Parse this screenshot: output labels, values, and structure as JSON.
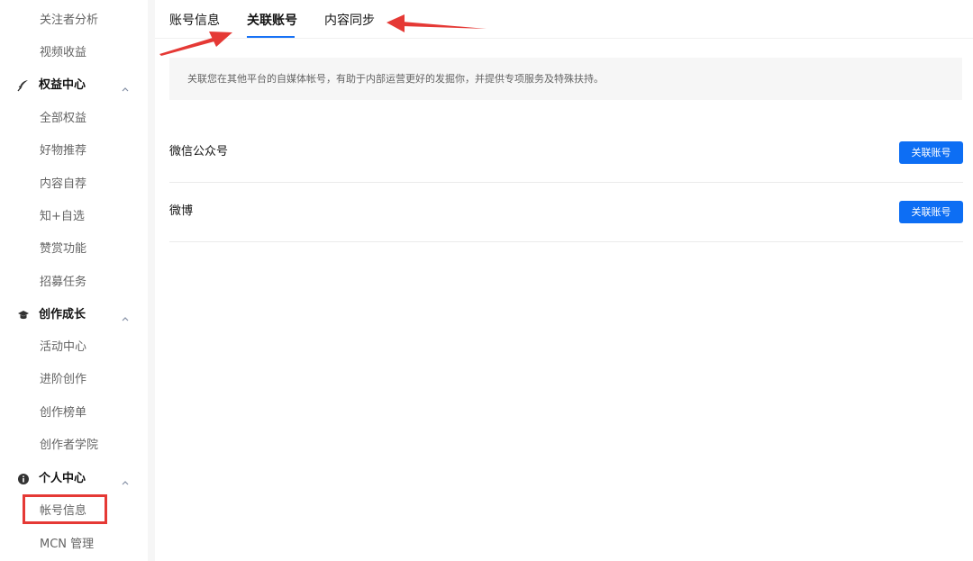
{
  "sidebar": {
    "items_top": [
      {
        "label": "关注者分析"
      },
      {
        "label": "视频收益"
      }
    ],
    "groups": [
      {
        "label": "权益中心",
        "icon": "feather-icon",
        "items": [
          {
            "label": "全部权益"
          },
          {
            "label": "好物推荐"
          },
          {
            "label": "内容自荐"
          },
          {
            "label": "知+自选"
          },
          {
            "label": "赞赏功能"
          },
          {
            "label": "招募任务"
          }
        ]
      },
      {
        "label": "创作成长",
        "icon": "graduation-cap-icon",
        "items": [
          {
            "label": "活动中心"
          },
          {
            "label": "进阶创作"
          },
          {
            "label": "创作榜单"
          },
          {
            "label": "创作者学院"
          }
        ]
      },
      {
        "label": "个人中心",
        "icon": "info-circle-icon",
        "items": [
          {
            "label": "帐号信息",
            "highlighted": true
          },
          {
            "label": "MCN 管理"
          }
        ]
      }
    ]
  },
  "tabs": [
    {
      "label": "账号信息",
      "active": false
    },
    {
      "label": "关联账号",
      "active": true
    },
    {
      "label": "内容同步",
      "active": false
    }
  ],
  "notice": {
    "text": "关联您在其他平台的自媒体帐号，有助于内部运营更好的发掘你，并提供专项服务及特殊扶持。"
  },
  "accounts": [
    {
      "name": "微信公众号",
      "button_label": "关联账号"
    },
    {
      "name": "微博",
      "button_label": "关联账号"
    }
  ],
  "colors": {
    "accent": "#1772f6",
    "button": "#0d6ef4",
    "annotation": "#e53935"
  }
}
